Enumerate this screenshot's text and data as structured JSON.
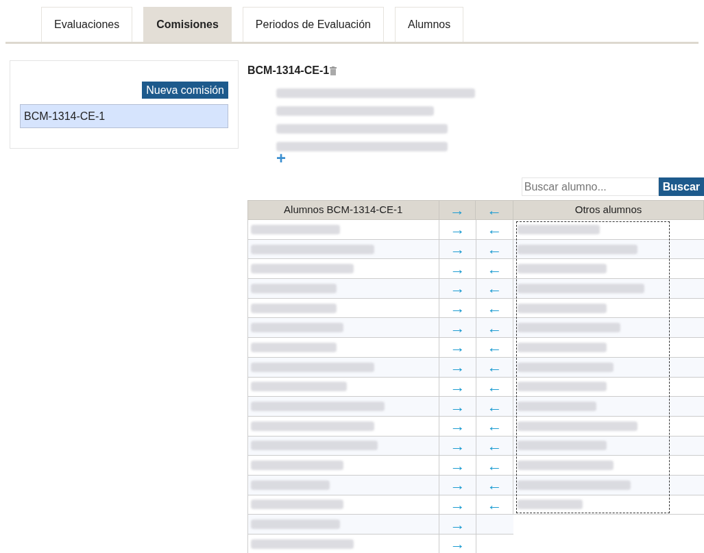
{
  "tabs": [
    {
      "label": "Evaluaciones",
      "selected": false
    },
    {
      "label": "Comisiones",
      "selected": true
    },
    {
      "label": "Periodos de Evaluación",
      "selected": false
    },
    {
      "label": "Alumnos",
      "selected": false
    }
  ],
  "sidebar": {
    "new_button": "Nueva comisión",
    "items": [
      {
        "label": "BCM-1314-CE-1",
        "selected": true
      }
    ]
  },
  "detail": {
    "title": "BCM-1314-CE-1",
    "add_symbol": "+"
  },
  "search": {
    "placeholder": "Buscar alumno...",
    "button": "Buscar"
  },
  "table": {
    "columns": [
      "Alumnos BCM-1314-CE-1",
      "→",
      "←",
      "Otros alumnos"
    ],
    "rows": [
      {
        "right_arrow": "→",
        "left_arrow": "←"
      },
      {
        "right_arrow": "→",
        "left_arrow": "←"
      },
      {
        "right_arrow": "→",
        "left_arrow": "←"
      },
      {
        "right_arrow": "→",
        "left_arrow": "←"
      },
      {
        "right_arrow": "→",
        "left_arrow": "←"
      },
      {
        "right_arrow": "→",
        "left_arrow": "←"
      },
      {
        "right_arrow": "→",
        "left_arrow": "←"
      },
      {
        "right_arrow": "→",
        "left_arrow": "←"
      },
      {
        "right_arrow": "→",
        "left_arrow": "←"
      },
      {
        "right_arrow": "→",
        "left_arrow": "←"
      },
      {
        "right_arrow": "→",
        "left_arrow": "←"
      },
      {
        "right_arrow": "→",
        "left_arrow": "←"
      },
      {
        "right_arrow": "→",
        "left_arrow": "←"
      },
      {
        "right_arrow": "→",
        "left_arrow": "←"
      },
      {
        "right_arrow": "→",
        "left_arrow": "←"
      },
      {
        "right_arrow": "→"
      },
      {
        "right_arrow": "→"
      }
    ]
  }
}
